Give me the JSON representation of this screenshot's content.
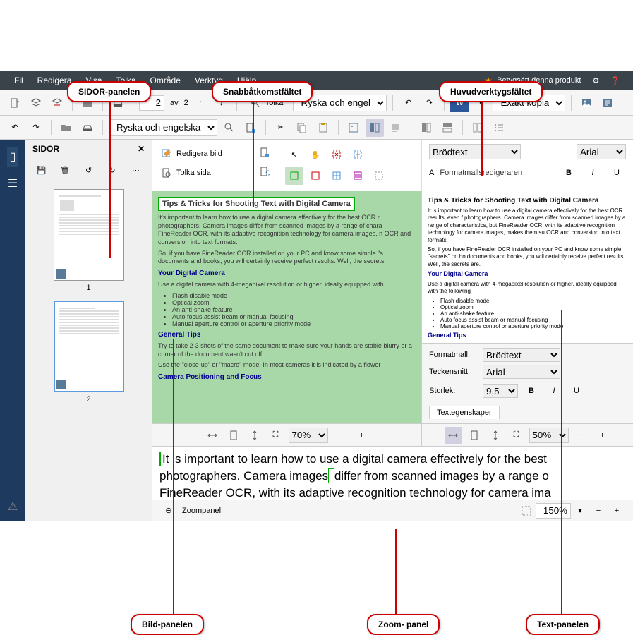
{
  "callouts": {
    "sidor": "SIDOR-panelen",
    "snabb": "Snabbåtkomstfältet",
    "huvud": "Huvudverktygsfältet",
    "bild": "Bild-panelen",
    "zoom": "Zoom- panel",
    "text": "Text-panelen"
  },
  "menubar": {
    "fil": "Fil",
    "redigera": "Redigera",
    "visa": "Visa",
    "tolka": "Tolka",
    "omrade": "Område",
    "verktyg": "Verktyg",
    "hjalp": "Hjälp",
    "rate": "Betygsätt denna produkt"
  },
  "toolbar": {
    "page_current": "2",
    "page_sep": "av",
    "page_total": "2",
    "tolka": "Tolka",
    "lang": "Ryska och engel",
    "exakt": "Exakt kopia",
    "word": "W"
  },
  "toolbar2": {
    "lang": "Ryska och engelska"
  },
  "pages": {
    "title": "SIDOR",
    "thumbs": [
      {
        "label": "1"
      },
      {
        "label": "2"
      }
    ]
  },
  "edit": {
    "redigera_bild": "Redigera bild",
    "tolka_sida": "Tolka sida",
    "style": "Brödtext",
    "font": "Arial",
    "format_link": "Formatmallsredigeraren"
  },
  "image_panel": {
    "title": "Tips & Tricks for Shooting Text with Digital Camera",
    "p1": "It's important to learn how to use a digital camera effectively for the best OCR r photographers. Camera images differ from scanned images by a range of chara FineReader OCR, with its adaptive recognition technology for camera images, n OCR and conversion into text formats.",
    "p2": "So, if you have FineReader OCR installed on your PC and know some simple \"s documents and books, you will certainly receive perfect results. Well, the secrets",
    "h1": "Your Digital Camera",
    "p3": "Use a digital camera with 4-megapixel resolution or higher, ideally equipped with",
    "li1": "Flash disable mode",
    "li2": "Optical zoom",
    "li3": "An anti-shake feature",
    "li4": "Auto focus assist beam or manual focusing",
    "li5": "Manual aperture control or aperture priority mode",
    "h2": "General Tips",
    "p4": "Try to take 2-3 shots of the same document to make sure your hands are stable blurry or a corner of the document wasn't cut off.",
    "p5": "Use the \"close-up\" or \"macro\" mode. In most cameras it is indicated by a flower",
    "h3": "Camera Positioning and Focus"
  },
  "text_panel": {
    "title": "Tips & Tricks for Shooting Text with Digital Camera",
    "p1": "It is important to learn how to use a digital camera effectively for the best OCR results, even f photographers. Camera images differ from scanned images by a range of characteristics, but FineReader OCR, with its adaptive recognition technology for camera images, makes them su OCR and conversion into text formats.",
    "p2": "So, if you have FineReader OCR installed on your PC and know some simple \"secrets\" on ho documents and books, you will certainly receive perfect results. Well, the secrets are.",
    "h1": "Your Digital Camera",
    "p3": "Use a digital camera with 4-megapixel resolution or higher, ideally equipped with the following",
    "li1": "Flash disable mode",
    "li2": "Optical zoom",
    "li3": "An anti-shake feature",
    "li4": "Auto focus assist beam or manual focusing",
    "li5": "Manual aperture control or aperture priority mode",
    "h2": "General Tips"
  },
  "props": {
    "formatmall_label": "Formatmall:",
    "formatmall": "Brödtext",
    "teckensnitt_label": "Teckensnitt:",
    "teckensnitt": "Arial",
    "storlek_label": "Storlek:",
    "storlek": "9,5",
    "tab": "Textegenskaper"
  },
  "zoombar": {
    "left_pct": "70%",
    "right_pct": "50%"
  },
  "zoom_text": {
    "line1a": "It is important to learn how to use a digital camera effectively for the best",
    "line2a": "photographers. Camera images",
    "line2b": "differ from scanned images by a range o",
    "line3": "FineReader OCR, with its adaptive recognition technology for camera ima"
  },
  "bottom": {
    "zoompanel": "Zoompanel",
    "zoom": "150%"
  }
}
